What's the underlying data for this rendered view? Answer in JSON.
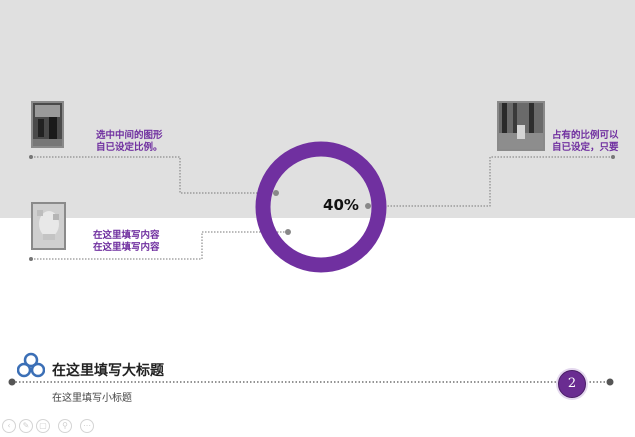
{
  "left_top": {
    "line1": "选中中间的图形",
    "line2": "自已设定比例。"
  },
  "left_bottom": {
    "line1": "在这里填写内容",
    "line2": "在这里填写内容"
  },
  "right_top": {
    "line1": "占有的比例可以",
    "line2": "自已设定，只要"
  },
  "donut": {
    "label": "40%",
    "value": 0.4,
    "color": "#7030a0"
  },
  "footer": {
    "title": "在这里填写大标题",
    "subtitle": "在这里填写小标题",
    "page_number": "2"
  },
  "colors": {
    "accent": "#7030a0",
    "band": "#e0e0e0",
    "logo": "#3b6fb6"
  },
  "toolbar": {
    "icons": [
      "prev-arrow-icon",
      "pen-icon",
      "slides-icon",
      "zoom-icon",
      "more-icon"
    ]
  }
}
